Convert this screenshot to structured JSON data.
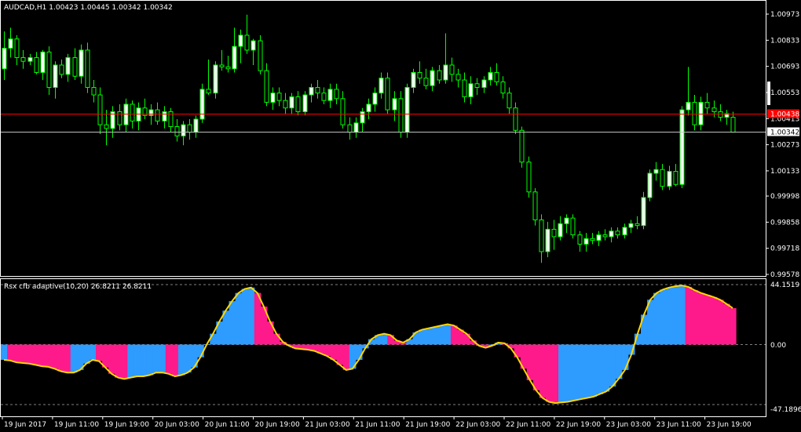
{
  "colors": {
    "background": "#000000",
    "frame": "#ffffff",
    "bull_candle": "#ffffff",
    "bear_candle": "#000000",
    "wick": "#00ff00",
    "bid_line": "#ff0000",
    "ask_line": "#c0c0c0",
    "bid_label_bg": "#ff0000",
    "rsx_up": "#2e9bff",
    "rsx_down": "#ff1a8c",
    "rsx_line": "#ffd700",
    "level_line": "#808080"
  },
  "main_chart": {
    "title": "AUDCAD,H1  1.00423 1.00445 1.00342 1.00342",
    "price_ticks": [
      "1.00973",
      "1.00833",
      "1.00693",
      "1.00553",
      "1.00413",
      "1.00273",
      "1.00133",
      "0.99998",
      "0.99858",
      "0.99718",
      "0.99578"
    ],
    "bid_label": "1.00438",
    "ask_label": "1.00342"
  },
  "sub_chart": {
    "title": "Rsx cfb adaptive(10,20) 26.8211 26.8211",
    "level_ticks": [
      "44.1519",
      "0.00",
      "-47.1896"
    ]
  },
  "time_axis": {
    "labels": [
      "19 Jun 2017",
      "19 Jun 11:00",
      "19 Jun 19:00",
      "20 Jun 03:00",
      "20 Jun 11:00",
      "20 Jun 19:00",
      "21 Jun 03:00",
      "21 Jun 11:00",
      "21 Jun 19:00",
      "22 Jun 03:00",
      "22 Jun 11:00",
      "22 Jun 19:00",
      "23 Jun 03:00",
      "23 Jun 11:00",
      "23 Jun 19:00"
    ]
  },
  "chart_data": {
    "type": "candlestick",
    "symbol": "AUDCAD",
    "timeframe": "H1",
    "ylim": [
      0.99578,
      1.00973
    ],
    "bid": 1.00438,
    "ask": 1.00342,
    "candles": [
      {
        "o": 1.0068,
        "h": 1.0088,
        "l": 1.0062,
        "c": 1.0079
      },
      {
        "o": 1.0079,
        "h": 1.009,
        "l": 1.0074,
        "c": 1.0084
      },
      {
        "o": 1.0084,
        "h": 1.0086,
        "l": 1.007,
        "c": 1.0074
      },
      {
        "o": 1.0074,
        "h": 1.0078,
        "l": 1.0068,
        "c": 1.0072
      },
      {
        "o": 1.0072,
        "h": 1.0076,
        "l": 1.007,
        "c": 1.0074
      },
      {
        "o": 1.0074,
        "h": 1.0077,
        "l": 1.0065,
        "c": 1.0066
      },
      {
        "o": 1.0066,
        "h": 1.0078,
        "l": 1.0062,
        "c": 1.0077
      },
      {
        "o": 1.0077,
        "h": 1.008,
        "l": 1.0054,
        "c": 1.0058
      },
      {
        "o": 1.0058,
        "h": 1.0072,
        "l": 1.0052,
        "c": 1.007
      },
      {
        "o": 1.007,
        "h": 1.0073,
        "l": 1.0063,
        "c": 1.0065
      },
      {
        "o": 1.0065,
        "h": 1.0076,
        "l": 1.0061,
        "c": 1.0074
      },
      {
        "o": 1.0074,
        "h": 1.0079,
        "l": 1.0062,
        "c": 1.0064
      },
      {
        "o": 1.0064,
        "h": 1.0081,
        "l": 1.006,
        "c": 1.0078
      },
      {
        "o": 1.0078,
        "h": 1.0082,
        "l": 1.0055,
        "c": 1.0058
      },
      {
        "o": 1.0058,
        "h": 1.0062,
        "l": 1.005,
        "c": 1.0054
      },
      {
        "o": 1.0054,
        "h": 1.0058,
        "l": 1.0033,
        "c": 1.0038
      },
      {
        "o": 1.0038,
        "h": 1.0046,
        "l": 1.0027,
        "c": 1.0036
      },
      {
        "o": 1.0036,
        "h": 1.0048,
        "l": 1.0031,
        "c": 1.0045
      },
      {
        "o": 1.0045,
        "h": 1.0049,
        "l": 1.0035,
        "c": 1.0038
      },
      {
        "o": 1.0038,
        "h": 1.0052,
        "l": 1.0034,
        "c": 1.0049
      },
      {
        "o": 1.0049,
        "h": 1.0051,
        "l": 1.0036,
        "c": 1.004
      },
      {
        "o": 1.004,
        "h": 1.005,
        "l": 1.0035,
        "c": 1.0047
      },
      {
        "o": 1.0047,
        "h": 1.0052,
        "l": 1.0041,
        "c": 1.0043
      },
      {
        "o": 1.0043,
        "h": 1.0049,
        "l": 1.0038,
        "c": 1.0046
      },
      {
        "o": 1.0046,
        "h": 1.005,
        "l": 1.0038,
        "c": 1.004
      },
      {
        "o": 1.004,
        "h": 1.0048,
        "l": 1.0036,
        "c": 1.0045
      },
      {
        "o": 1.0045,
        "h": 1.0047,
        "l": 1.0034,
        "c": 1.0037
      },
      {
        "o": 1.0037,
        "h": 1.0041,
        "l": 1.0029,
        "c": 1.0032
      },
      {
        "o": 1.0032,
        "h": 1.004,
        "l": 1.0027,
        "c": 1.0038
      },
      {
        "o": 1.0038,
        "h": 1.0041,
        "l": 1.003,
        "c": 1.0034
      },
      {
        "o": 1.0034,
        "h": 1.0043,
        "l": 1.0031,
        "c": 1.0041
      },
      {
        "o": 1.0041,
        "h": 1.006,
        "l": 1.0039,
        "c": 1.0057
      },
      {
        "o": 1.0057,
        "h": 1.0073,
        "l": 1.0054,
        "c": 1.0055
      },
      {
        "o": 1.0055,
        "h": 1.0072,
        "l": 1.0052,
        "c": 1.007
      },
      {
        "o": 1.007,
        "h": 1.0078,
        "l": 1.0067,
        "c": 1.0069
      },
      {
        "o": 1.0069,
        "h": 1.0075,
        "l": 1.0066,
        "c": 1.0068
      },
      {
        "o": 1.0068,
        "h": 1.009,
        "l": 1.0066,
        "c": 1.008
      },
      {
        "o": 1.008,
        "h": 1.0089,
        "l": 1.0071,
        "c": 1.0086
      },
      {
        "o": 1.0086,
        "h": 1.0097,
        "l": 1.0076,
        "c": 1.0078
      },
      {
        "o": 1.0078,
        "h": 1.0084,
        "l": 1.007,
        "c": 1.0083
      },
      {
        "o": 1.0083,
        "h": 1.0086,
        "l": 1.0065,
        "c": 1.0067
      },
      {
        "o": 1.0067,
        "h": 1.0071,
        "l": 1.0048,
        "c": 1.005
      },
      {
        "o": 1.005,
        "h": 1.0058,
        "l": 1.0046,
        "c": 1.0055
      },
      {
        "o": 1.0055,
        "h": 1.0058,
        "l": 1.0048,
        "c": 1.0051
      },
      {
        "o": 1.0051,
        "h": 1.0055,
        "l": 1.0044,
        "c": 1.0047
      },
      {
        "o": 1.0047,
        "h": 1.0055,
        "l": 1.0044,
        "c": 1.0053
      },
      {
        "o": 1.0053,
        "h": 1.0056,
        "l": 1.0043,
        "c": 1.0045
      },
      {
        "o": 1.0045,
        "h": 1.0056,
        "l": 1.0043,
        "c": 1.0054
      },
      {
        "o": 1.0054,
        "h": 1.006,
        "l": 1.005,
        "c": 1.0058
      },
      {
        "o": 1.0058,
        "h": 1.0062,
        "l": 1.0052,
        "c": 1.0055
      },
      {
        "o": 1.0055,
        "h": 1.0058,
        "l": 1.0049,
        "c": 1.0051
      },
      {
        "o": 1.0051,
        "h": 1.006,
        "l": 1.0047,
        "c": 1.0057
      },
      {
        "o": 1.0057,
        "h": 1.006,
        "l": 1.0049,
        "c": 1.0052
      },
      {
        "o": 1.0052,
        "h": 1.0056,
        "l": 1.0036,
        "c": 1.0038
      },
      {
        "o": 1.0038,
        "h": 1.0042,
        "l": 1.003,
        "c": 1.0034
      },
      {
        "o": 1.0034,
        "h": 1.0042,
        "l": 1.0031,
        "c": 1.0039
      },
      {
        "o": 1.0039,
        "h": 1.0047,
        "l": 1.0034,
        "c": 1.0045
      },
      {
        "o": 1.0045,
        "h": 1.0052,
        "l": 1.0041,
        "c": 1.0049
      },
      {
        "o": 1.0049,
        "h": 1.0058,
        "l": 1.0045,
        "c": 1.0055
      },
      {
        "o": 1.0055,
        "h": 1.0066,
        "l": 1.0052,
        "c": 1.0063
      },
      {
        "o": 1.0063,
        "h": 1.0066,
        "l": 1.0044,
        "c": 1.0046
      },
      {
        "o": 1.0046,
        "h": 1.0056,
        "l": 1.004,
        "c": 1.0052
      },
      {
        "o": 1.0052,
        "h": 1.0056,
        "l": 1.0031,
        "c": 1.0034
      },
      {
        "o": 1.0034,
        "h": 1.006,
        "l": 1.0031,
        "c": 1.0058
      },
      {
        "o": 1.0058,
        "h": 1.0068,
        "l": 1.0055,
        "c": 1.0066
      },
      {
        "o": 1.0066,
        "h": 1.0072,
        "l": 1.006,
        "c": 1.0063
      },
      {
        "o": 1.0063,
        "h": 1.0068,
        "l": 1.0057,
        "c": 1.0059
      },
      {
        "o": 1.0059,
        "h": 1.0069,
        "l": 1.0056,
        "c": 1.0067
      },
      {
        "o": 1.0067,
        "h": 1.007,
        "l": 1.006,
        "c": 1.0062
      },
      {
        "o": 1.0062,
        "h": 1.0087,
        "l": 1.006,
        "c": 1.007
      },
      {
        "o": 1.007,
        "h": 1.0074,
        "l": 1.0061,
        "c": 1.0065
      },
      {
        "o": 1.0065,
        "h": 1.0068,
        "l": 1.0058,
        "c": 1.0062
      },
      {
        "o": 1.0062,
        "h": 1.0066,
        "l": 1.005,
        "c": 1.0053
      },
      {
        "o": 1.0053,
        "h": 1.0064,
        "l": 1.0049,
        "c": 1.006
      },
      {
        "o": 1.006,
        "h": 1.0063,
        "l": 1.0054,
        "c": 1.0058
      },
      {
        "o": 1.0058,
        "h": 1.0064,
        "l": 1.0055,
        "c": 1.0062
      },
      {
        "o": 1.0062,
        "h": 1.0069,
        "l": 1.0059,
        "c": 1.0066
      },
      {
        "o": 1.0066,
        "h": 1.0071,
        "l": 1.0059,
        "c": 1.0061
      },
      {
        "o": 1.0061,
        "h": 1.0064,
        "l": 1.0052,
        "c": 1.0055
      },
      {
        "o": 1.0055,
        "h": 1.0058,
        "l": 1.0044,
        "c": 1.0047
      },
      {
        "o": 1.0047,
        "h": 1.005,
        "l": 1.0033,
        "c": 1.0035
      },
      {
        "o": 1.0035,
        "h": 1.0037,
        "l": 1.0015,
        "c": 1.0018
      },
      {
        "o": 1.0018,
        "h": 1.0021,
        "l": 0.9999,
        "c": 1.0002
      },
      {
        "o": 1.0002,
        "h": 1.0004,
        "l": 0.9984,
        "c": 0.9987
      },
      {
        "o": 0.9987,
        "h": 0.999,
        "l": 0.9964,
        "c": 0.997
      },
      {
        "o": 0.997,
        "h": 0.9986,
        "l": 0.9967,
        "c": 0.9982
      },
      {
        "o": 0.9982,
        "h": 0.9987,
        "l": 0.9971,
        "c": 0.9978
      },
      {
        "o": 0.9978,
        "h": 0.9989,
        "l": 0.9976,
        "c": 0.9985
      },
      {
        "o": 0.9985,
        "h": 0.999,
        "l": 0.998,
        "c": 0.9988
      },
      {
        "o": 0.9988,
        "h": 0.999,
        "l": 0.9977,
        "c": 0.9979
      },
      {
        "o": 0.9979,
        "h": 0.9981,
        "l": 0.997,
        "c": 0.9974
      },
      {
        "o": 0.9974,
        "h": 0.998,
        "l": 0.997,
        "c": 0.9977
      },
      {
        "o": 0.9977,
        "h": 0.998,
        "l": 0.9974,
        "c": 0.9976
      },
      {
        "o": 0.9976,
        "h": 0.9981,
        "l": 0.9973,
        "c": 0.9979
      },
      {
        "o": 0.9979,
        "h": 0.9982,
        "l": 0.9976,
        "c": 0.9978
      },
      {
        "o": 0.9978,
        "h": 0.9983,
        "l": 0.9975,
        "c": 0.9981
      },
      {
        "o": 0.9981,
        "h": 0.9983,
        "l": 0.9977,
        "c": 0.9979
      },
      {
        "o": 0.9979,
        "h": 0.9985,
        "l": 0.9977,
        "c": 0.9983
      },
      {
        "o": 0.9983,
        "h": 0.9987,
        "l": 0.998,
        "c": 0.9985
      },
      {
        "o": 0.9985,
        "h": 0.9989,
        "l": 0.9982,
        "c": 0.9984
      },
      {
        "o": 0.9984,
        "h": 1.0002,
        "l": 0.9982,
        "c": 0.9999
      },
      {
        "o": 0.9999,
        "h": 1.0014,
        "l": 0.9997,
        "c": 1.0012
      },
      {
        "o": 1.0012,
        "h": 1.0018,
        "l": 1.0008,
        "c": 1.0014
      },
      {
        "o": 1.0014,
        "h": 1.0017,
        "l": 1.0003,
        "c": 1.0005
      },
      {
        "o": 1.0005,
        "h": 1.0016,
        "l": 1.0003,
        "c": 1.0013
      },
      {
        "o": 1.0013,
        "h": 1.0017,
        "l": 1.0005,
        "c": 1.0006
      },
      {
        "o": 1.0006,
        "h": 1.0048,
        "l": 1.0004,
        "c": 1.0046
      },
      {
        "o": 1.0046,
        "h": 1.0069,
        "l": 1.0043,
        "c": 1.005
      },
      {
        "o": 1.005,
        "h": 1.0054,
        "l": 1.0035,
        "c": 1.0038
      },
      {
        "o": 1.0038,
        "h": 1.0053,
        "l": 1.0035,
        "c": 1.005
      },
      {
        "o": 1.005,
        "h": 1.0055,
        "l": 1.0044,
        "c": 1.0047
      },
      {
        "o": 1.0047,
        "h": 1.0051,
        "l": 1.0042,
        "c": 1.0045
      },
      {
        "o": 1.0045,
        "h": 1.0049,
        "l": 1.004,
        "c": 1.0042
      },
      {
        "o": 1.0042,
        "h": 1.0046,
        "l": 1.0038,
        "c": 1.0044
      },
      {
        "o": 1.0042,
        "h": 1.0045,
        "l": 1.0034,
        "c": 1.0034
      }
    ],
    "rsx": [
      -12.0,
      -12.5,
      -14.0,
      -14.5,
      -15.0,
      -16.0,
      -17.0,
      -17.5,
      -19.0,
      -21.0,
      -22.0,
      -22.0,
      -20.0,
      -15.0,
      -12.0,
      -13.0,
      -18.0,
      -23.0,
      -26.0,
      -27.0,
      -26.0,
      -25.0,
      -25.0,
      -24.0,
      -22.0,
      -22.0,
      -23.0,
      -25.0,
      -24.0,
      -22.0,
      -18.0,
      -10.0,
      0.0,
      8.0,
      17.0,
      25.0,
      32.0,
      38.0,
      41.0,
      42.0,
      38.0,
      28.0,
      17.0,
      8.0,
      2.0,
      -1.0,
      -3.0,
      -3.5,
      -4.0,
      -5.0,
      -7.0,
      -9.0,
      -12.0,
      -16.0,
      -20.0,
      -19.0,
      -12.0,
      -3.0,
      4.0,
      7.0,
      8.0,
      7.0,
      3.0,
      1.5,
      4.0,
      9.0,
      11.0,
      12.0,
      13.0,
      14.0,
      15.0,
      14.0,
      11.0,
      8.0,
      3.0,
      -1.0,
      -2.5,
      -1.0,
      1.5,
      1.0,
      -3.0,
      -10.0,
      -19.0,
      -28.0,
      -36.0,
      -42.0,
      -45.0,
      -46.0,
      -45.5,
      -45.0,
      -44.0,
      -43.0,
      -42.0,
      -41.0,
      -39.0,
      -37.0,
      -33.0,
      -27.0,
      -20.0,
      -8.0,
      8.0,
      22.0,
      33.0,
      38.0,
      40.5,
      42.0,
      43.0,
      43.5,
      42.5,
      40.0,
      38.0,
      36.5,
      35.0,
      33.0,
      30.0,
      26.8211
    ],
    "rsx_range": [
      -47.1896,
      44.1519
    ]
  }
}
